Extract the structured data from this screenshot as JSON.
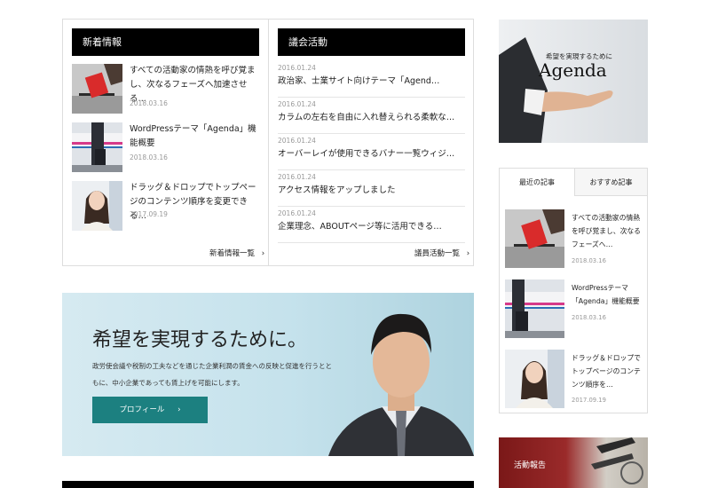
{
  "news": {
    "heading": "新着情報",
    "items": [
      {
        "title": "すべての活動家の情熱を呼び覚まし、次なるフェーズへ加速させる…",
        "date": "2018.03.16"
      },
      {
        "title": "WordPressテーマ「Agenda」機能概要",
        "date": "2018.03.16"
      },
      {
        "title": "ドラッグ＆ドロップでトップページのコンテンツ順序を変更できる…",
        "date": "2017.09.19"
      }
    ],
    "more": "新着情報一覧"
  },
  "activity": {
    "heading": "議会活動",
    "items": [
      {
        "date": "2016.01.24",
        "title": "政治家、士業サイト向けテーマ「Agend…"
      },
      {
        "date": "2016.01.24",
        "title": "カラムの左右を自由に入れ替えられる柔軟な…"
      },
      {
        "date": "2016.01.24",
        "title": "オーバーレイが使用できるバナー一覧ウィジ…"
      },
      {
        "date": "2016.01.24",
        "title": "アクセス情報をアップしました"
      },
      {
        "date": "2016.01.24",
        "title": "企業理念、ABOUTページ等に活用できる…"
      }
    ],
    "more": "議員活動一覧"
  },
  "hero": {
    "title": "希望を実現するために。",
    "text": "政労使会議や税制の工夫などを通じた企業利潤の賃金への反映と促進を行うとともに、中小企業であっても賃上げを可能にします。",
    "button": "プロフィール"
  },
  "agenda_banner": {
    "subtitle": "希望を実現するために",
    "title": "Agenda"
  },
  "sidebar": {
    "tabs": [
      "最近の記事",
      "おすすめ記事"
    ],
    "items": [
      {
        "title": "すべての活動家の情熱を呼び覚まし、次なるフェーズへ…",
        "date": "2018.03.16"
      },
      {
        "title": "WordPressテーマ「Agenda」機能概要",
        "date": "2018.03.16"
      },
      {
        "title": "ドラッグ＆ドロップでトップページのコンテンツ順序を…",
        "date": "2017.09.19"
      }
    ],
    "banner_label": "活動報告"
  },
  "colors": {
    "header_bg": "#000000",
    "button_teal": "#1c8080",
    "border": "#dddddd",
    "date_gray": "#999999"
  }
}
